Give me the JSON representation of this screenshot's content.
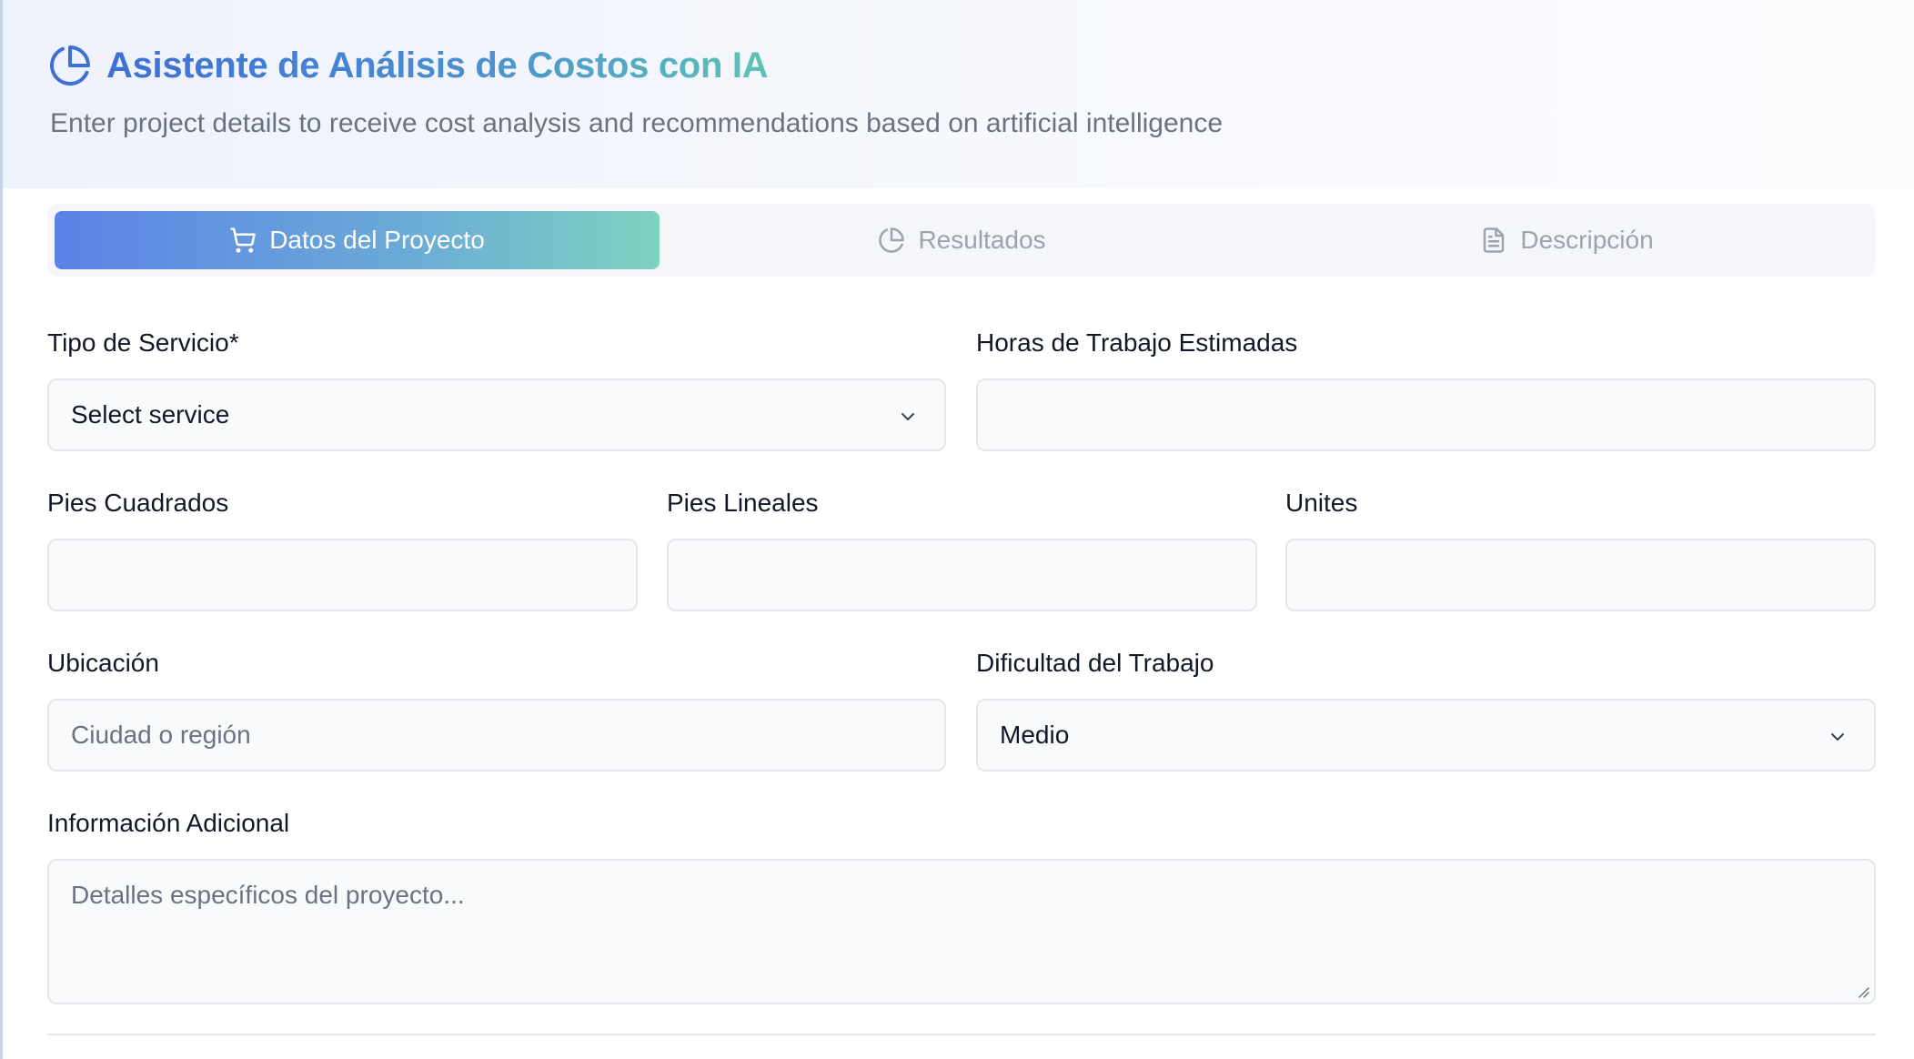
{
  "header": {
    "title": "Asistente de Análisis de Costos con IA",
    "subtitle": "Enter project details to receive cost analysis and recommendations based on artificial intelligence"
  },
  "tabs": [
    {
      "label": "Datos del Proyecto",
      "icon": "cart-icon",
      "active": true
    },
    {
      "label": "Resultados",
      "icon": "pie-chart-icon",
      "active": false
    },
    {
      "label": "Descripción",
      "icon": "document-icon",
      "active": false
    }
  ],
  "form": {
    "service_type": {
      "label": "Tipo de Servicio*",
      "value": "Select service"
    },
    "hours": {
      "label": "Horas de Trabajo Estimadas",
      "value": ""
    },
    "square_feet": {
      "label": "Pies Cuadrados",
      "value": ""
    },
    "linear_feet": {
      "label": "Pies Lineales",
      "value": ""
    },
    "units": {
      "label": "Unites",
      "value": ""
    },
    "location": {
      "label": "Ubicación",
      "placeholder": "Ciudad o región",
      "value": ""
    },
    "difficulty": {
      "label": "Dificultad del Trabajo",
      "value": "Medio"
    },
    "additional_info": {
      "label": "Información Adicional",
      "placeholder": "Detalles específicos del proyecto...",
      "value": ""
    }
  },
  "colors": {
    "accent_start": "#5b82e6",
    "accent_end": "#7dd3c0",
    "title_start": "#3f6fd6",
    "title_end": "#5cc3b6"
  }
}
